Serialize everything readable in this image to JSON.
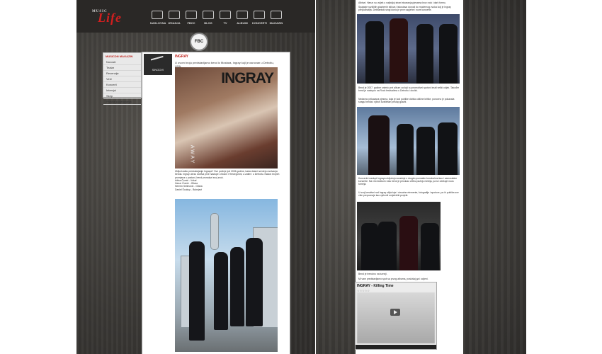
{
  "site": {
    "logo_text": "Life",
    "logo_small": "MUSIC"
  },
  "nav": [
    "NASLOVNA",
    "IZDANJA",
    "FBCC",
    "BLOG",
    "TV",
    "ALBUMI",
    "KONCERTI",
    "MAGAZIN"
  ],
  "fbc_label": "FBC",
  "sidebar": {
    "title": "MUSICDN MAGAZIN",
    "items": [
      "Novosti",
      "Teatar",
      "Recenzije",
      "Vinil",
      "Koncerti",
      "Intervjui",
      "Skrip",
      "Pravila sudjelovanja"
    ]
  },
  "section": {
    "label": "INGRAY",
    "badge": "SINGOVI"
  },
  "article": {
    "lead": "U ovom broju predstavljamo bend iz Mostara, Ingray koji je osnovan u Detroitu, USA.",
    "cover_title": "INGRAY",
    "cover_sub": "AWAY",
    "paragraph": "Zbilja kratko predstavljanje Ingraya? Sve počinje još 2006 godine, kada dolazi na ideju osnivanja benda. Ingray ubrzo dobiva prve nastupe u Bosni i Hercegovini, a zatim i u Detroitu. Nakon brojnih promjena u postavi, bend pronalazi svoj zvuk.",
    "members": [
      "Adisa Čomić - Vokal",
      "Harun Čomić - Gitara",
      "Nermin Selimović - Gitara",
      "Daniel Šoukup - Bubnjevi"
    ]
  },
  "right": {
    "intro": "Albina i Harun su uvijek u najboljoj strani stvaranja pjesama kroz rock i dark formu.",
    "p1": "Spajanje različitih glazbenih stilova i iskustava dovodi do modernog zvuka koji je Ingray prepoznatljiv. Debitantski singl donio je prve uspjehe i nove koncerte.",
    "p2": "Bend je 2007. godine snimio prvi album za koji su promotivni spotovi imali veliki odjek. Također bend je nastupio na Rock festivalima u Detroitu i okolici.",
    "p3": "Nedavno prikazana pjesma, koja je kod publike dobila odlične kritike, ponovno je pokazala snagu benda i njihov kvalitetan pristup glazbi.",
    "p4": "Koncertni nastupi Ingraya uključuju suradnje s drugim poznatim bendovima kao i samostalne koncerte. Na vrlo kratkom roku bend je privukao veliku pažnju medija, pa se očekuje nova turneja.",
    "p5": "U svoj kreativni rad Ingray uključuje i vizualne elemente, fotografije i spotove, pa ih publika sve više prepoznaje kao cjeloviti umjetnički projekt.",
    "p6": "Bend je trenutno na turneji.",
    "p7": "Mi vam predstavljamo spot sa prvog albuma, poslušaj ga i ocijeni.",
    "video_title": "INGRAY - Killing Time",
    "video_stars": "☆☆☆☆☆"
  }
}
